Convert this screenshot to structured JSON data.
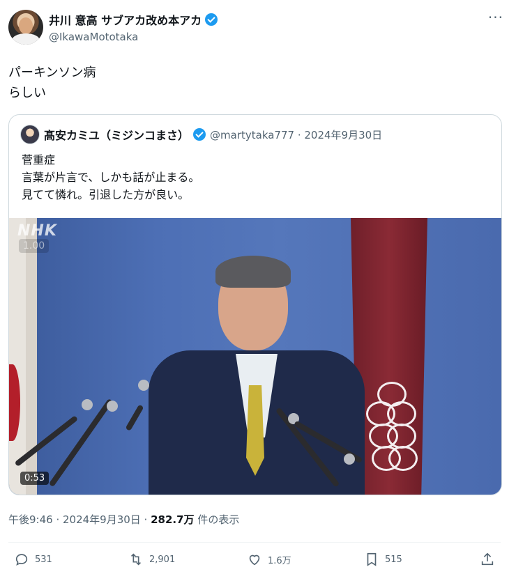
{
  "author": {
    "name": "井川 意高 サブアカ改め本アカ",
    "handle": "@IkawaMototaka",
    "verified": true
  },
  "tweet": {
    "lines": [
      "パーキンソン病",
      "らしい"
    ]
  },
  "quoted": {
    "name": "髙安カミユ（ミジンコまさ）",
    "meta": "@martytaka777 · 2024年9月30日",
    "lines": [
      "菅重症",
      "言葉が片言で、しかも話が止まる。",
      "見てて憐れ。引退した方が良い。"
    ],
    "video": {
      "watermark": "NHK",
      "speed": "1.00",
      "duration": "0:53"
    }
  },
  "footer": {
    "time": "午後9:46 · 2024年9月30日 · ",
    "views": "282.7万",
    "views_suffix": " 件の表示"
  },
  "actions": {
    "reply_count": "531",
    "retweet_count": "2,901",
    "like_count": "1.6万",
    "bookmark_count": "515"
  },
  "colors": {
    "verified": "#1d9bf0",
    "secondary_text": "#536471"
  }
}
